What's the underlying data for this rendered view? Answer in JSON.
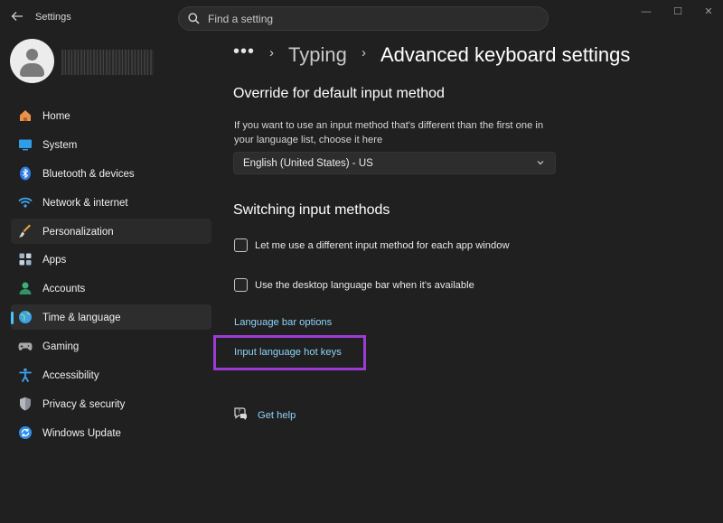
{
  "titlebar": {
    "app_title": "Settings",
    "back_icon": "back-arrow-icon"
  },
  "search": {
    "placeholder": "Find a setting"
  },
  "window_controls": {
    "minimize": "—",
    "maximize": "☐",
    "close": "✕"
  },
  "nav": [
    {
      "label": "Home",
      "icon": "home-icon",
      "color": "#e8924a"
    },
    {
      "label": "System",
      "icon": "system-icon",
      "color": "#2f9de8"
    },
    {
      "label": "Bluetooth & devices",
      "icon": "bluetooth-icon",
      "color": "#2f7de8"
    },
    {
      "label": "Network & internet",
      "icon": "wifi-icon",
      "color": "#3fa6f0"
    },
    {
      "label": "Personalization",
      "icon": "brush-icon",
      "color": "#e6a040",
      "state": "hover"
    },
    {
      "label": "Apps",
      "icon": "apps-icon",
      "color": "#9fb4c9"
    },
    {
      "label": "Accounts",
      "icon": "accounts-icon",
      "color": "#3db07a"
    },
    {
      "label": "Time & language",
      "icon": "globe-icon",
      "color": "#3da0e8",
      "state": "active"
    },
    {
      "label": "Gaming",
      "icon": "gamepad-icon",
      "color": "#a8a8a8"
    },
    {
      "label": "Accessibility",
      "icon": "accessibility-icon",
      "color": "#3ba1f2"
    },
    {
      "label": "Privacy & security",
      "icon": "shield-icon",
      "color": "#8a8f99"
    },
    {
      "label": "Windows Update",
      "icon": "update-icon",
      "color": "#2f8fe8"
    }
  ],
  "breadcrumb": {
    "more": "•••",
    "parent": "Typing",
    "current": "Advanced keyboard settings"
  },
  "override": {
    "heading": "Override for default input method",
    "description_line1": "If you want to use an input method that's different than the first one in",
    "description_line2": "your language list, choose it here",
    "selected": "English (United States) - US"
  },
  "switching": {
    "heading": "Switching input methods",
    "option1": "Let me use a different input method for each app window",
    "option2": "Use the desktop language bar when it's available"
  },
  "links": {
    "language_bar": "Language bar options",
    "hot_keys": "Input language hot keys",
    "get_help": "Get help"
  },
  "colors": {
    "accent": "#4cc2ff",
    "highlight_box": "#9b3bd3",
    "link": "#8ed3f7"
  }
}
